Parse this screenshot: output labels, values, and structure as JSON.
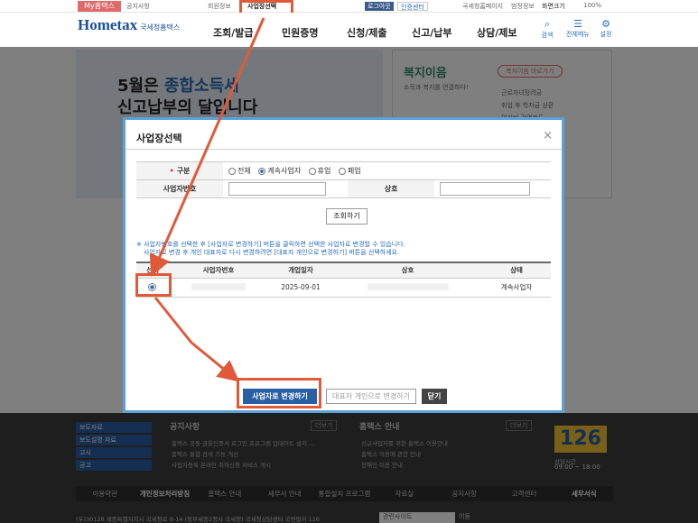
{
  "topbar": {
    "mytax": "My홈택스",
    "items": [
      "공지사항",
      "회원정보",
      "사업장선택"
    ],
    "login": "로그아웃",
    "cert": "인증센터",
    "links": [
      "국세청홈페이지",
      "범정정보",
      "화면크기",
      "100%"
    ]
  },
  "header": {
    "logo": "Hometax",
    "logo_sub": "국세청홈택스",
    "nav": [
      "조회/발급",
      "민원증명",
      "신청/제출",
      "신고/납부",
      "상담/제보"
    ],
    "icons": [
      "검색",
      "전체메뉴",
      "설정"
    ]
  },
  "banner": {
    "line1a": "5월은 ",
    "line1b": "종합소득세",
    "line2": "신고납부의 달입니다"
  },
  "welfare": {
    "title": "복지이음",
    "link": "복지이음 바로가기",
    "desc": "소득과 복지를 연결하다!",
    "items": [
      "근로자녀장려금",
      "취업 후 학자금 상환",
      "의거비 감면제도"
    ]
  },
  "modal": {
    "title": "사업장선택",
    "close": "×",
    "filter": {
      "type_label": "구분",
      "options": [
        "전체",
        "계속사업자",
        "휴업",
        "폐업"
      ],
      "bizno_label": "사업자번호",
      "name_label": "상호"
    },
    "search_button": "조회하기",
    "notes": [
      "※ 사업자번호를 선택한 후 [사업자로 변경하기] 버튼을 클릭하면 선택한 사업자로 변경할 수 있습니다.",
      "사업자로 변경 후 개인 대표자로 다시 변경하려면 [대표자 개인으로 변경하기] 버튼을 선택하세요."
    ],
    "table": {
      "headers": [
        "선택",
        "사업자번호",
        "개업일자",
        "상호",
        "상태"
      ],
      "rows": [
        {
          "bizno": "",
          "open_date": "2025-09-01",
          "name": "",
          "status": "계속사업자"
        }
      ]
    },
    "buttons": {
      "change_biz": "사업자로 변경하기",
      "change_rep": "대표자 개인으로 변경하기",
      "close": "닫기"
    }
  },
  "footer": {
    "left_menu": [
      "보도자료",
      "보도설명 자료",
      "고시",
      "공고"
    ],
    "notice_title": "공지사항",
    "notice_more": "더보기",
    "notices": [
      "홈택스 공동·금융인증서 로그인 프로그램 업데이트 설치 ...",
      "홈택스 통합 검색 기능 개선",
      "사업자등록 온라인 취하신청 서비스 개시"
    ],
    "guide_title": "홈택스 안내",
    "guide_more": "더보기",
    "guides": [
      "신규사업자를 위한 홈택스 이용안내",
      "홈택스 이용에 관한 안내",
      "장애인 이용 안내"
    ],
    "call_number": "126",
    "call_label": "상담시간",
    "call_hours": "09:00 ~ 18:00",
    "nav": [
      "이용약관",
      "개인정보처리방침",
      "홈택스 안내",
      "세무서 안내",
      "통합설치 프로그램",
      "자료실",
      "공지사항",
      "고객센터",
      "세무서식"
    ],
    "address": "(우)30128 세종특별자치시 국세청로 8-14 (정부세종2청사 국세청) 국세청상담센터 국번없이 126",
    "related": "관련사이트",
    "go": "이동"
  },
  "colors": {
    "accent": "#2a5ea5",
    "highlight": "#e05a3a",
    "modal_border": "#5aa2d8"
  }
}
